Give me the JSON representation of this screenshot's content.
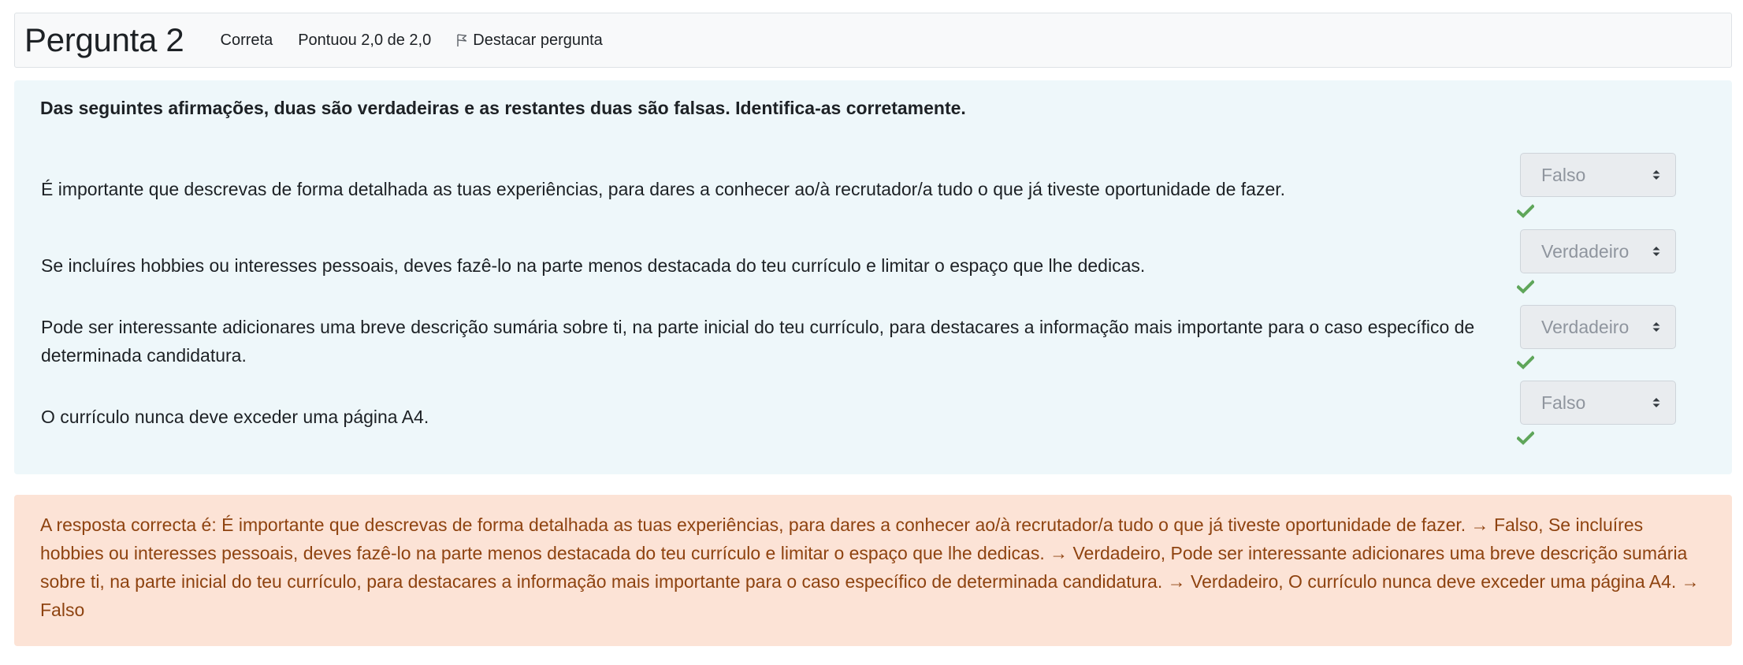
{
  "header": {
    "title": "Pergunta 2",
    "state": "Correta",
    "grade": "Pontuou 2,0 de 2,0",
    "flag_label": "Destacar pergunta",
    "flag_icon": "flag-icon"
  },
  "question": {
    "text": "Das seguintes afirmações, duas são verdadeiras e as restantes duas são falsas. Identifica-as corretamente.",
    "items": [
      {
        "statement": "É importante que descrevas de forma detalhada as tuas experiências, para dares a conhecer ao/à recrutador/a tudo o que já tiveste oportunidade de fazer.",
        "selected": "Falso",
        "mark_icon": "check-icon"
      },
      {
        "statement": "Se incluíres hobbies ou interesses pessoais, deves fazê-lo na parte menos destacada do teu currículo e limitar o espaço que lhe dedicas.",
        "selected": "Verdadeiro",
        "mark_icon": "check-icon"
      },
      {
        "statement": "Pode ser interessante adicionares uma breve descrição sumária sobre ti, na parte inicial do teu currículo, para destacares a informação mais importante para o caso específico de determinada candidatura.",
        "selected": "Verdadeiro",
        "mark_icon": "check-icon"
      },
      {
        "statement": "O currículo nunca deve exceder uma página A4.",
        "selected": "Falso",
        "mark_icon": "check-icon"
      }
    ]
  },
  "feedback": {
    "right_answer": "A resposta correcta é: É importante que descrevas de forma detalhada as tuas experiências, para dares a conhecer ao/à recrutador/a tudo o que já tiveste oportunidade de fazer. → Falso, Se incluíres hobbies ou interesses pessoais, deves fazê-lo na parte menos destacada do teu currículo e limitar o espaço que lhe dedicas. → Verdadeiro, Pode ser interessante adicionares uma breve descrição sumária sobre ti, na parte inicial do teu currículo, para destacares a informação mais importante para o caso específico de determinada candidatura. → Verdadeiro, O currículo nunca deve exceder uma página A4. → Falso"
  },
  "colors": {
    "info_background": "#f8f9fa",
    "formulation_background": "#eef7fa",
    "feedback_background": "#fce3d6",
    "feedback_text": "#8e4310",
    "correct_mark": "#5fa65a",
    "select_background": "#e9ecef"
  }
}
